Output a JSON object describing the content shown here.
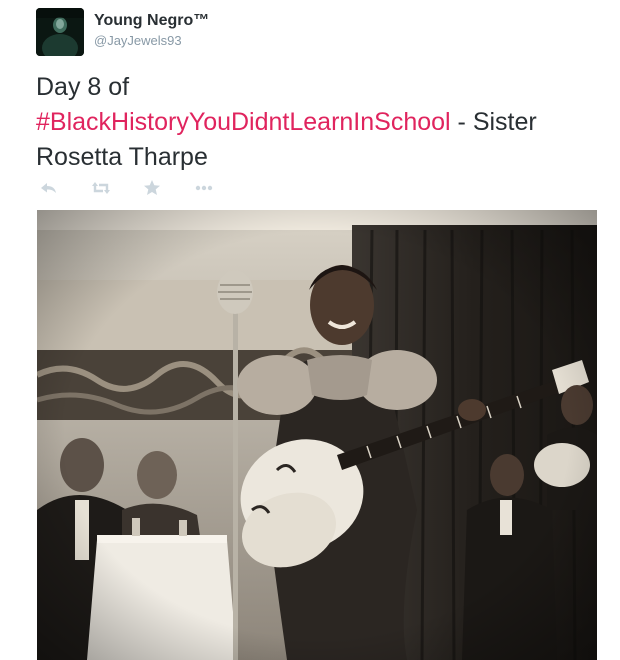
{
  "tweet": {
    "author": {
      "name": "Young Negro™",
      "handle": "@JayJewels93"
    },
    "text": {
      "prefix": "Day 8 of",
      "hashtag": "#BlackHistoryYouDidntLearnInSchool",
      "suffix": " - Sister Rosetta Tharpe"
    },
    "actions": [
      {
        "icon": "reply-icon"
      },
      {
        "icon": "retweet-icon"
      },
      {
        "icon": "favorite-star-icon"
      },
      {
        "icon": "more-options-icon"
      }
    ],
    "colors": {
      "hashtag": "#e0245e",
      "action_icons": "#ccd6dd",
      "handle": "#8899a6"
    }
  }
}
